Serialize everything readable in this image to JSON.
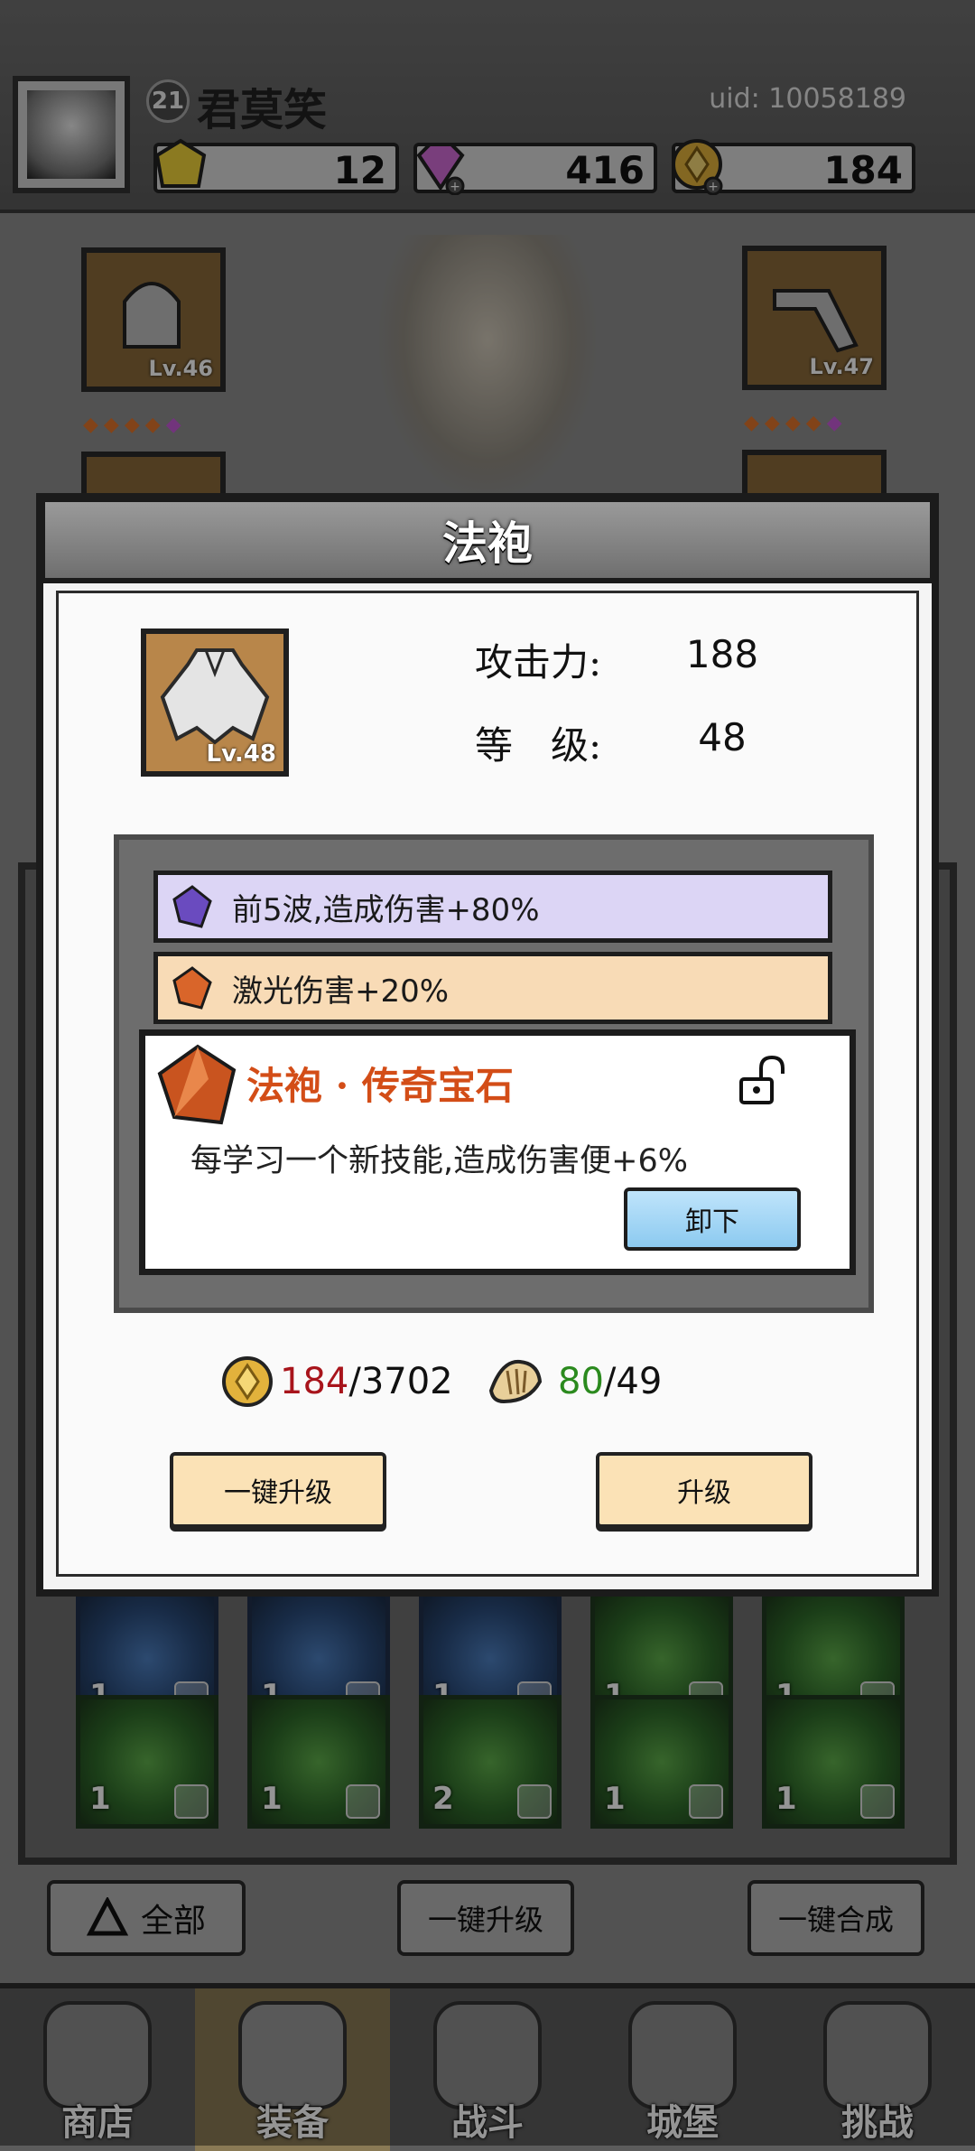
{
  "player": {
    "level": "21",
    "name": "君莫笑",
    "uid": "uid: 10058189"
  },
  "currencies": {
    "gold_gem": "12",
    "diamond": "416",
    "coin": "184"
  },
  "equipment": {
    "left_slot_level": "Lv.46",
    "right_slot_level": "Lv.47"
  },
  "inventory": {
    "row1_counts": [
      "1",
      "1",
      "1",
      "1",
      "1"
    ],
    "row2_counts": [
      "1",
      "1",
      "2",
      "1",
      "1"
    ]
  },
  "actions": {
    "filter_label": "全部",
    "upgrade_all": "一键升级",
    "merge_all": "一键合成"
  },
  "nav": {
    "shop": "商店",
    "equipment": "装备",
    "battle": "战斗",
    "castle": "城堡",
    "challenge": "挑战",
    "active_index": 1
  },
  "modal": {
    "title": "法袍",
    "item_level": "Lv.48",
    "attack_label": "攻击力:",
    "attack_value": "188",
    "level_label": "等　级:",
    "level_value": "48",
    "affixes": [
      {
        "text": "前5波,造成伤害+80%",
        "color": "#d9d2f5",
        "gem_color": "#6a4bbf"
      },
      {
        "text": "激光伤害+20%",
        "color": "#f8d9b5",
        "gem_color": "#d9652a"
      }
    ],
    "legendary": {
      "title": "法袍 · 传奇宝石",
      "description": "每学习一个新技能,造成伤害便+6%",
      "button": "卸下"
    },
    "cost": {
      "coin_have": "184",
      "coin_need": "/3702",
      "scroll_have": "80",
      "scroll_need": "/49"
    },
    "buttons": {
      "upgrade_all": "一键升级",
      "upgrade": "升级"
    }
  },
  "colors": {
    "legend_title": "#d34d17",
    "coin_short": "#a8141b",
    "scroll_ok": "#2b8a1e",
    "upgrade_button": "#fbe2b6",
    "unequip_button": "#9fd3f3"
  }
}
